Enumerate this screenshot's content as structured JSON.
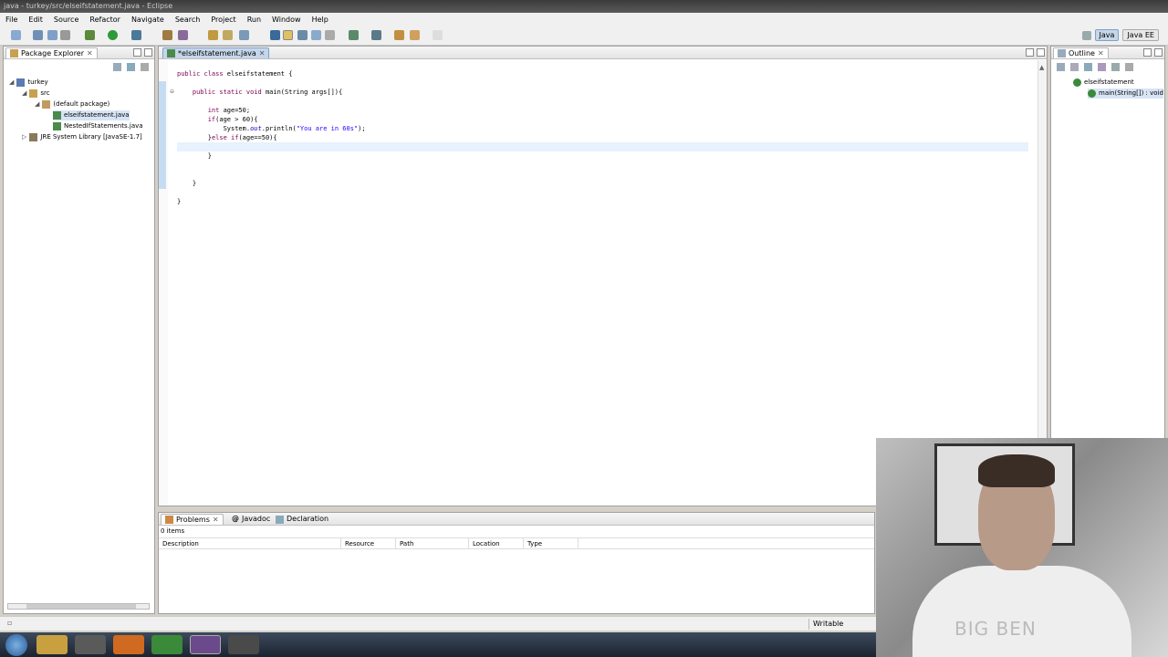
{
  "window": {
    "title": "java - turkey/src/elseifstatement.java - Eclipse"
  },
  "menu": [
    "File",
    "Edit",
    "Source",
    "Refactor",
    "Navigate",
    "Search",
    "Project",
    "Run",
    "Window",
    "Help"
  ],
  "perspectives": {
    "java": "Java",
    "javaee": "Java EE"
  },
  "package_explorer": {
    "tab": "Package Explorer",
    "tree": {
      "project": "turkey",
      "src": "src",
      "default_package": "(default package)",
      "file1": "elseifstatement.java",
      "file2": "NestedIfStatements.java",
      "jre": "JRE System Library [JavaSE-1.7]"
    }
  },
  "editor": {
    "tab": "*elseifstatement.java",
    "code": {
      "l1_kw": "public class ",
      "l1_rest": "elseifstatement {",
      "l2_kw": "public static void ",
      "l2_rest": "main(String args[]){",
      "l3_kw": "int ",
      "l3_rest": "age=50;",
      "l4_kw": "if",
      "l4_rest": "(age > 60){",
      "l5_a": "System.",
      "l5_fld": "out",
      "l5_b": ".println(",
      "l5_str": "\"You are in 60s\"",
      "l5_c": ");",
      "l6_a": "}",
      "l6_kw": "else if",
      "l6_rest": "(age==50){",
      "l7": "}",
      "l8": "}",
      "l9": "}"
    }
  },
  "outline": {
    "tab": "Outline",
    "class": "elseifstatement",
    "method": "main(String[]) : void"
  },
  "problems": {
    "tabs": [
      "Problems",
      "Javadoc",
      "Declaration"
    ],
    "count": "0 items",
    "columns": [
      "Description",
      "Resource",
      "Path",
      "Location",
      "Type"
    ]
  },
  "status": {
    "writable": "Writable"
  },
  "webcam": {
    "shirt_text": "BIG BEN"
  }
}
